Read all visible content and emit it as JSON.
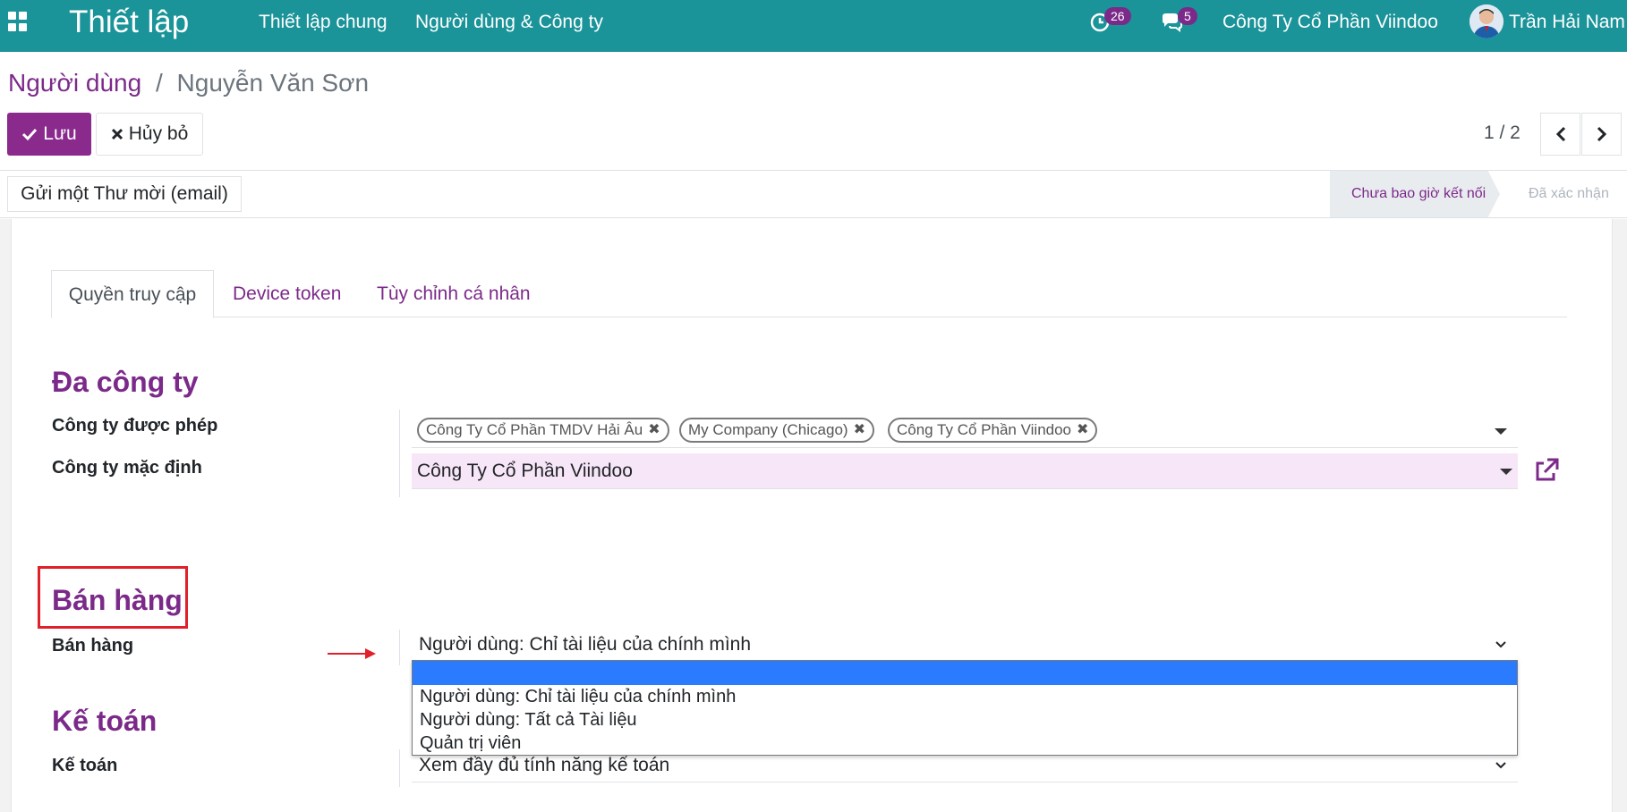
{
  "topbar": {
    "app_title": "Thiết lập",
    "nav": [
      "Thiết lập chung",
      "Người dùng & Công ty"
    ],
    "activity_count": "26",
    "message_count": "5",
    "company": "Công Ty Cổ Phần Viindoo",
    "user_name": "Trần Hải Nam",
    "color": "#1a9399"
  },
  "breadcrumb": {
    "parent": "Người dùng",
    "separator": "/",
    "current": "Nguyễn Văn Sơn"
  },
  "actions": {
    "save_label": "Lưu",
    "discard_label": "Hủy bỏ"
  },
  "pager": {
    "value": "1 / 2"
  },
  "statusbar": {
    "invite_label": "Gửi một Thư mời (email)",
    "stages": [
      {
        "label": "Chưa bao giờ kết nối",
        "current": true
      },
      {
        "label": "Đã xác nhận",
        "current": false
      }
    ]
  },
  "tabs": [
    {
      "label": "Quyền truy cập",
      "active": true
    },
    {
      "label": "Device token",
      "active": false
    },
    {
      "label": "Tùy chỉnh cá nhân",
      "active": false
    }
  ],
  "sections": {
    "multi_company": {
      "title": "Đa công ty",
      "allowed_label": "Công ty được phép",
      "allowed_tags": [
        "Công Ty Cổ Phần TMDV Hải Âu",
        "My Company (Chicago)",
        "Công Ty Cổ Phần Viindoo"
      ],
      "default_label": "Công ty mặc định",
      "default_value": "Công Ty Cổ Phần Viindoo"
    },
    "sales": {
      "title": "Bán hàng",
      "field_label": "Bán hàng",
      "value": "Người dùng: Chỉ tài liệu của chính mình",
      "options": [
        "",
        "Người dùng: Chỉ tài liệu của chính mình",
        "Người dùng: Tất cả Tài liệu",
        "Quản trị viên"
      ]
    },
    "accounting": {
      "title": "Kế toán",
      "field_label": "Kế toán",
      "value": "Xem đầy đủ tính năng kế toán"
    }
  },
  "colors": {
    "primary": "#8a2a8d",
    "accent_text": "#7c2a8a",
    "highlight": "#e0202a",
    "option_selected": "#2b7bff"
  }
}
